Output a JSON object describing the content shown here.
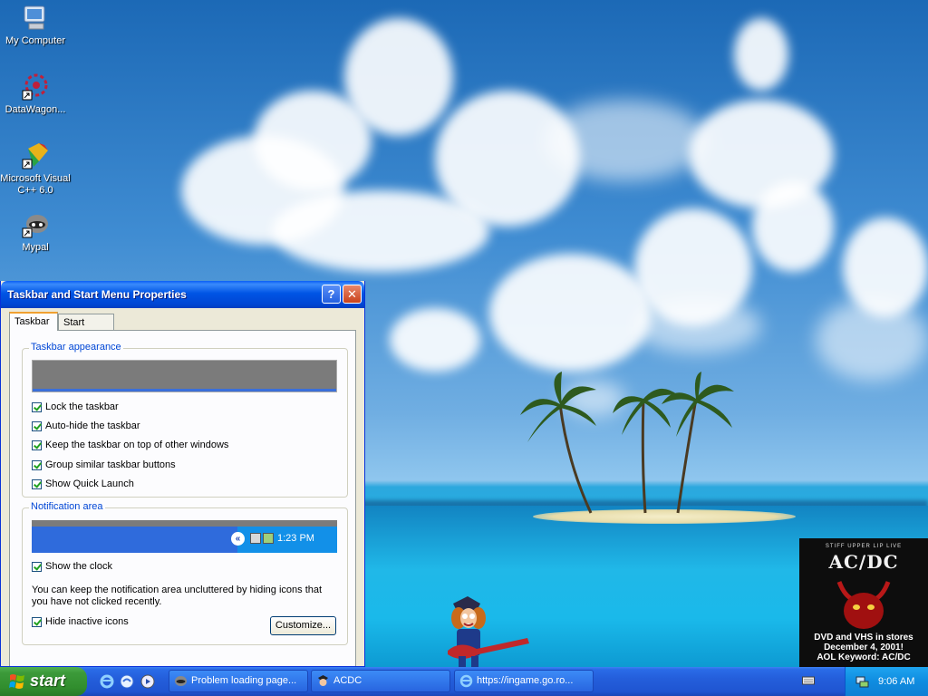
{
  "desktop": {
    "icons": [
      {
        "label": "My Computer",
        "icon": "computer-icon"
      },
      {
        "label": "DataWagon...",
        "icon": "datawagon-icon"
      },
      {
        "label": "Microsoft Visual C++ 6.0",
        "icon": "visual-cpp-icon"
      },
      {
        "label": "Mypal",
        "icon": "mypal-icon"
      }
    ],
    "ad": {
      "tiny": "STIFF UPPER LIP LIVE",
      "logo": "AC/DC",
      "line1": "DVD and VHS in stores",
      "line2": "December 4, 2001!",
      "line3": "AOL Keyword: AC/DC"
    }
  },
  "dialog": {
    "title": "Taskbar and Start Menu Properties",
    "help_glyph": "?",
    "close_glyph": "✕",
    "tabs": [
      {
        "label": "Taskbar",
        "selected": true
      },
      {
        "label": "Start Menu",
        "selected": false
      }
    ],
    "appearance": {
      "legend": "Taskbar appearance",
      "options": [
        {
          "label": "Lock the taskbar",
          "checked": true
        },
        {
          "label": "Auto-hide the taskbar",
          "checked": true
        },
        {
          "label": "Keep the taskbar on top of other windows",
          "checked": true
        },
        {
          "label": "Group similar taskbar buttons",
          "checked": true
        },
        {
          "label": "Show Quick Launch",
          "checked": true
        }
      ]
    },
    "notification": {
      "legend": "Notification area",
      "preview_time": "1:23 PM",
      "preview_arrow": "«",
      "show_clock": {
        "label": "Show the clock",
        "checked": true
      },
      "description": "You can keep the notification area uncluttered by hiding icons that you have not clicked recently.",
      "hide_inactive": {
        "label": "Hide inactive icons",
        "checked": true
      },
      "customize_label": "Customize..."
    }
  },
  "taskbar": {
    "start_label": "start",
    "tasks": [
      {
        "label": "Problem loading page...",
        "icon": "mypal-icon"
      },
      {
        "label": "ACDC",
        "icon": "acdc-icon"
      },
      {
        "label": "https://ingame.go.ro...",
        "icon": "ie-icon"
      }
    ],
    "clock": "9:06 AM"
  },
  "colors": {
    "xp_blue": "#245edb",
    "start_green": "#3c9a3a",
    "dialog_face": "#ece9d8",
    "legend_blue": "#0046d5"
  }
}
